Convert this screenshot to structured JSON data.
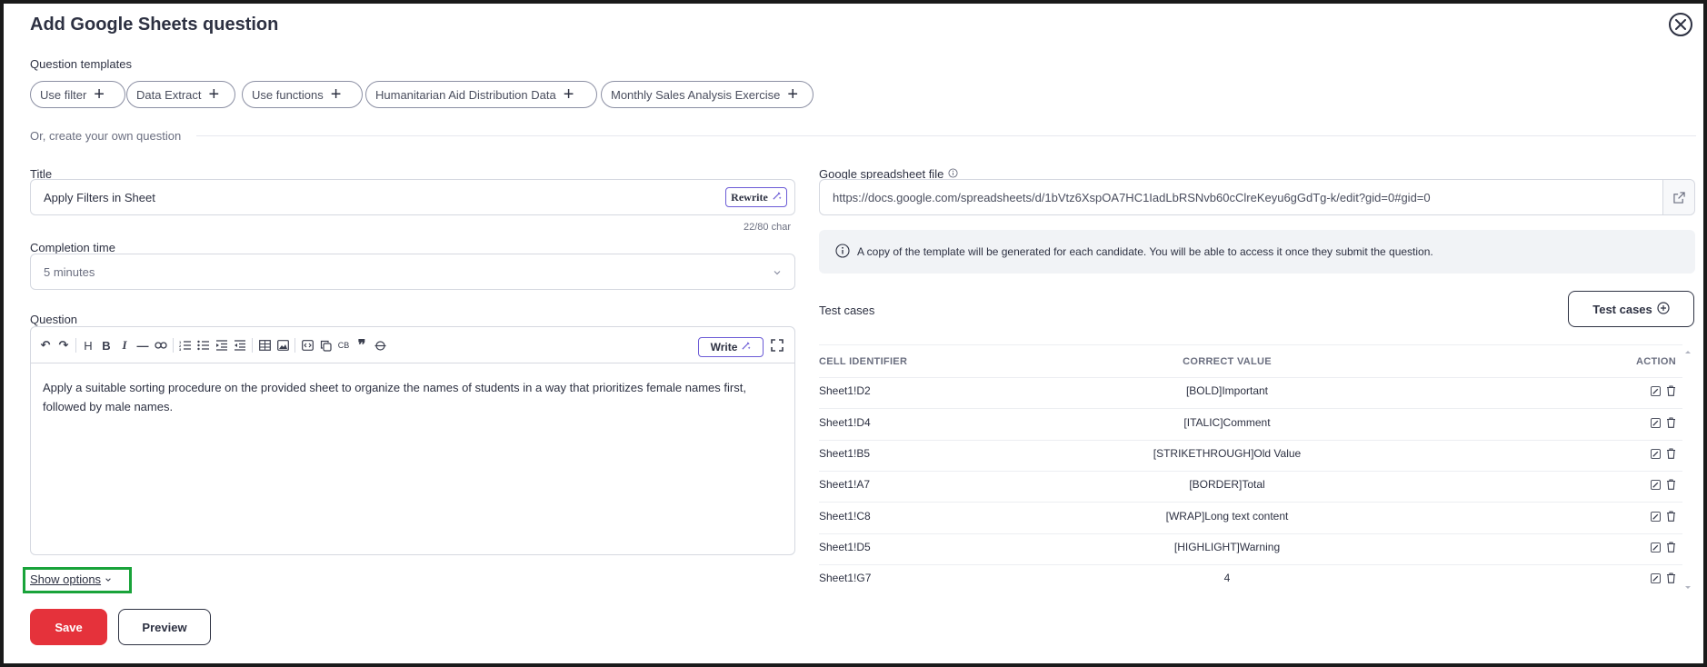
{
  "modal": {
    "title": "Add Google Sheets question",
    "close_icon": "close-circle-icon"
  },
  "templates": {
    "label": "Question templates",
    "items": [
      {
        "label": "Use filter"
      },
      {
        "label": "Data Extract"
      },
      {
        "label": "Use functions"
      },
      {
        "label": "Humanitarian Aid Distribution Data"
      },
      {
        "label": "Monthly Sales Analysis Exercise"
      }
    ],
    "own_label": "Or, create your own question"
  },
  "title_field": {
    "label": "Title",
    "value": "Apply Filters in Sheet",
    "rewrite_label": "Rewrite",
    "char_count": "22/80 char"
  },
  "completion": {
    "label": "Completion time",
    "value": "5 minutes"
  },
  "question": {
    "label": "Question",
    "write_label": "Write",
    "body": "Apply a suitable sorting procedure on the provided sheet to organize the names of students in a way that prioritizes female names first, followed by male names.",
    "toolbar_cb": "CB"
  },
  "show_options": "Show options",
  "spreadsheet": {
    "label": "Google spreadsheet file",
    "url": "https://docs.google.com/spreadsheets/d/1bVtz6XspOA7HC1IadLbRSNvb60cClreKeyu6gGdTg-k/edit?gid=0#gid=0",
    "info": "A copy of the template will be generated for each candidate. You will be able to access it once they submit the question."
  },
  "test_cases": {
    "label": "Test cases",
    "button_label": "Test cases",
    "columns": [
      "CELL IDENTIFIER",
      "CORRECT VALUE",
      "ACTION"
    ],
    "rows": [
      {
        "cell": "Sheet1!D2",
        "value": "[BOLD]Important"
      },
      {
        "cell": "Sheet1!D4",
        "value": "[ITALIC]Comment"
      },
      {
        "cell": "Sheet1!B5",
        "value": "[STRIKETHROUGH]Old Value"
      },
      {
        "cell": "Sheet1!A7",
        "value": "[BORDER]Total"
      },
      {
        "cell": "Sheet1!C8",
        "value": "[WRAP]Long text content"
      },
      {
        "cell": "Sheet1!D5",
        "value": "[HIGHLIGHT]Warning"
      },
      {
        "cell": "Sheet1!G7",
        "value": "4"
      }
    ]
  },
  "footer": {
    "save_label": "Save",
    "preview_label": "Preview"
  },
  "colors": {
    "primary": "#e5323b",
    "accent": "#6b5bd6",
    "highlight": "#19a33a"
  }
}
